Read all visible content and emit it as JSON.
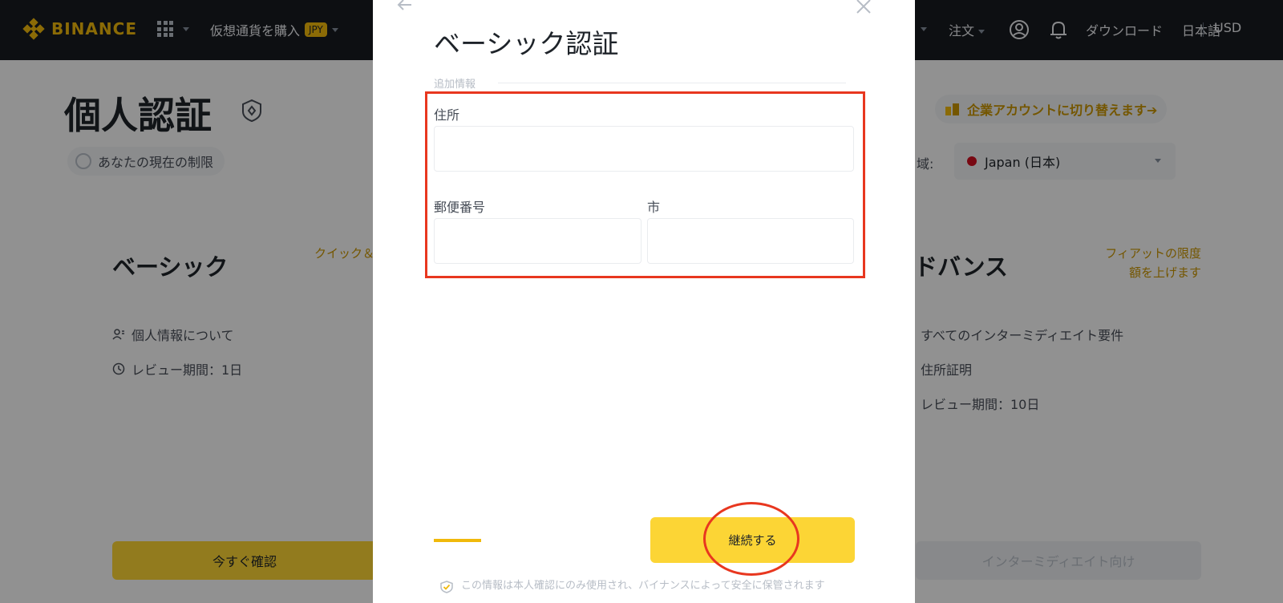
{
  "header": {
    "logo_text": "BINANCE",
    "buy_crypto": "仮想通貨を購入",
    "currency_badge": "JPY",
    "orders": "注文",
    "download": "ダウンロード",
    "language": "日本語",
    "fiat": "USD"
  },
  "page": {
    "title": "個人認証",
    "limit_pill": "あなたの現在の制限",
    "corporate_switch": "企業アカウントに切り替えます➔",
    "region_label": "域:",
    "region_value": "Japan (日本)"
  },
  "cards": {
    "basic": {
      "title": "ベーシック",
      "link": "クイック＆",
      "item1": "個人情報について",
      "item2": "レビュー期間：1日",
      "button": "今すぐ確認"
    },
    "advanced": {
      "title": "ドバンス",
      "link_line1": "フィアットの限度",
      "link_line2": "額を上げます",
      "item1": "すべてのインターミディエイト要件",
      "item2": "住所証明",
      "item3": "レビュー期間：10日",
      "button": "インターミディエイト向け"
    }
  },
  "modal": {
    "title": "ベーシック認証",
    "section_label": "追加情報",
    "address_label": "住所",
    "address_value": "",
    "postal_label": "郵便番号",
    "postal_value": "",
    "city_label": "市",
    "city_value": "",
    "continue_button": "継続する",
    "progress": 0.3,
    "footer_note": "この情報は本人確認にのみ使用され、バイナンスによって安全に保管されます"
  },
  "colors": {
    "brand_yellow": "#f0b90b",
    "button_yellow": "#fcd535",
    "annotation_red": "#e8371f",
    "topbar_bg": "#181a20"
  }
}
